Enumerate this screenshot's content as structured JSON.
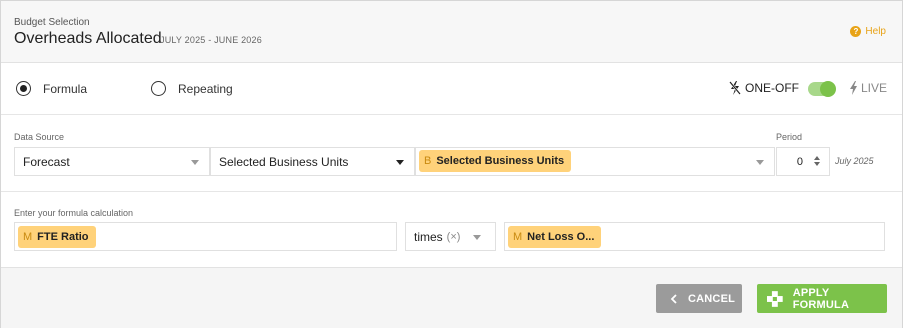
{
  "header": {
    "subtitle": "Budget Selection",
    "title": "Overheads Allocated",
    "period_range": "JULY 2025 - JUNE 2026",
    "help_label": "Help"
  },
  "mode": {
    "options": [
      {
        "label": "Formula",
        "selected": true
      },
      {
        "label": "Repeating",
        "selected": false
      }
    ],
    "oneoff_label": "ONE-OFF",
    "live_label": "LIVE",
    "toggle_on": true
  },
  "data_source": {
    "label": "Data Source",
    "source_value": "Forecast",
    "scope_value": "Selected Business Units",
    "chip": {
      "letter": "B",
      "label": "Selected Business Units"
    },
    "period_label": "Period",
    "period_value": "0",
    "period_date": "July 2025"
  },
  "formula": {
    "label": "Enter your formula calculation",
    "left_chip": {
      "letter": "M",
      "label": "FTE Ratio"
    },
    "operator": "times",
    "operator_symbol": "(×)",
    "right_chip": {
      "letter": "M",
      "label": "Net Loss O..."
    }
  },
  "footer": {
    "cancel_label": "CANCEL",
    "apply_label": "APPLY FORMULA"
  },
  "colors": {
    "accent_orange": "#e8a317",
    "chip_yellow": "#ffd27a",
    "green": "#7cc24a",
    "cancel_gray": "#9b9b9b"
  }
}
